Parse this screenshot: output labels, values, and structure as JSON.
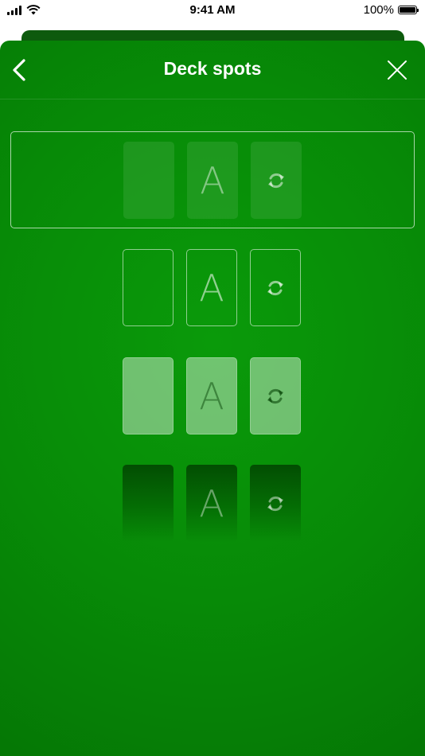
{
  "status_bar": {
    "time": "9:41 AM",
    "battery": "100%",
    "battery_level": 1.0,
    "icons": [
      "signal-icon",
      "wifi-icon",
      "battery-icon"
    ]
  },
  "nav": {
    "title": "Deck spots",
    "back_icon": "chevron-left-icon",
    "close_icon": "close-icon"
  },
  "colors": {
    "felt": "#078a07",
    "felt_dark": "#046f04",
    "text": "#ffffff"
  },
  "spot_labels": {
    "ace": "A",
    "recycle_icon": "recycle-icon"
  },
  "options": [
    {
      "style": "fill",
      "selected": true
    },
    {
      "style": "outline",
      "selected": false
    },
    {
      "style": "light",
      "selected": false
    },
    {
      "style": "dark",
      "selected": false
    }
  ]
}
